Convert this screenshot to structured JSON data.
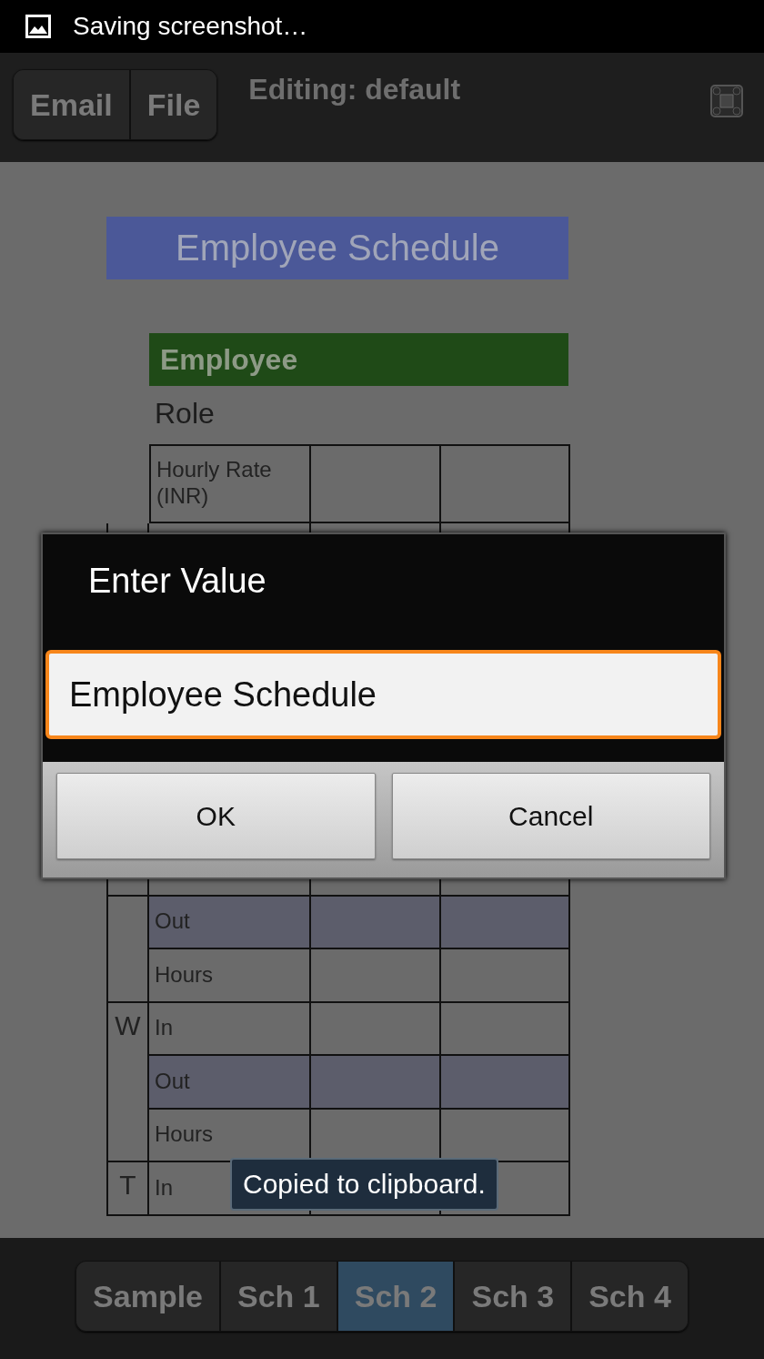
{
  "status_bar": {
    "text": "Saving screenshot…"
  },
  "toolbar": {
    "buttons": [
      {
        "label": "Email"
      },
      {
        "label": "File"
      }
    ],
    "title": "Editing: default"
  },
  "sheet": {
    "title": "Employee Schedule",
    "section": "Employee",
    "role": "Role",
    "rate_label": "Hourly Rate (INR)",
    "groups": [
      {
        "rows": [
          {
            "label": "Out",
            "shaded": true
          },
          {
            "label": "Hours",
            "shaded": false
          }
        ]
      },
      {
        "day": "W",
        "rows": [
          {
            "label": "In",
            "shaded": false
          },
          {
            "label": "Out",
            "shaded": true
          },
          {
            "label": "Hours",
            "shaded": false
          }
        ]
      },
      {
        "day": "T",
        "rows": [
          {
            "label": "In",
            "shaded": false
          }
        ]
      }
    ]
  },
  "dialog": {
    "title": "Enter Value",
    "value": "Employee Schedule",
    "buttons": [
      "OK",
      "Cancel"
    ]
  },
  "toast": {
    "text": "Copied to clipboard."
  },
  "sheet_tabs": [
    {
      "label": "Sample",
      "selected": false
    },
    {
      "label": "Sch 1",
      "selected": false
    },
    {
      "label": "Sch 2",
      "selected": true
    },
    {
      "label": "Sch 3",
      "selected": false
    },
    {
      "label": "Sch 4",
      "selected": false
    }
  ]
}
